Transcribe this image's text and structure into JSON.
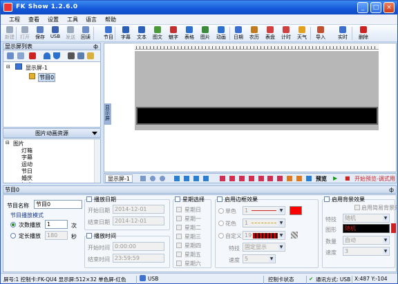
{
  "window": {
    "title": "FK Show 1.2.6.0",
    "btn_min": "_",
    "btn_max": "□",
    "btn_close": "×"
  },
  "menu": [
    "工程",
    "查看",
    "设置",
    "工具",
    "语言",
    "帮助"
  ],
  "toolbar": {
    "items": [
      "新建",
      "打开",
      "保存",
      "USB",
      "发送",
      "回读",
      "节目",
      "字幕",
      "文本",
      "图文",
      "魅字",
      "表格",
      "图片",
      "动画",
      "日期",
      "农历",
      "表盘",
      "计时",
      "天气",
      "导入",
      "实时",
      "删除"
    ],
    "disabled": [
      true,
      true,
      false,
      false,
      true,
      false,
      false,
      false,
      false,
      false,
      false,
      false,
      false,
      false,
      false,
      false,
      false,
      false,
      false,
      false,
      false,
      false
    ],
    "colors": [
      "#9aa8bb",
      "#9aa8bb",
      "#5a7fc0",
      "#3a5fb0",
      "#9aa8bb",
      "#6b8cc9",
      "#3a74d0",
      "#2b5fb8",
      "#2b5fb8",
      "#4a9a3a",
      "#c03030",
      "#2b6fcf",
      "#3d8a3d",
      "#2b6fcf",
      "#3b6fcf",
      "#c07a20",
      "#d04040",
      "#d04040",
      "#e0a020",
      "#c05030",
      "#3b6fcf",
      "#cc2222"
    ]
  },
  "left": {
    "list_title": "显示屏列表",
    "pin": "ф",
    "tree": [
      {
        "label": "显示屏-1",
        "level": 0
      },
      {
        "label": "节目0",
        "level": 1
      }
    ],
    "anim_title": "图片动画资源",
    "anim_tree": [
      "图片",
      "灯箱",
      "字幕",
      "运动",
      "节日",
      "婚庆",
      "好吉"
    ]
  },
  "canvas": {
    "vruler": "显示屏"
  },
  "bottom": {
    "tab": "显示屏-1",
    "preview": "预览",
    "play_label": "开始预览-调式用"
  },
  "props": {
    "title": "节目0",
    "pin": "ф",
    "program_name_label": "节目名称",
    "program_name": "节目0",
    "play_mode_label": "节目播放模式",
    "mode_count_label": "次数播放",
    "count_value": "1",
    "count_unit": "次",
    "mode_timed_label": "定长播放",
    "timed_value": "180",
    "timed_unit": "秒",
    "date_group": "播放日期",
    "start_date_label": "开始日期",
    "start_date": "2014-12-01",
    "end_date_label": "结束日期",
    "end_date": "2014-12-01",
    "time_group": "播放时间",
    "start_time_label": "开始时间",
    "start_time": "0:00:00",
    "end_time_label": "结束时间",
    "end_time": "23:59:59",
    "week_group": "星期选择",
    "weekdays": [
      "星期日",
      "星期一",
      "星期二",
      "星期三",
      "星期四",
      "星期五",
      "星期六"
    ],
    "border_group": "启用边框效果",
    "border_single": "单色",
    "border_single_val": "1",
    "border_color": "#ff0000",
    "border_flower": "花色",
    "border_flower_val": "1",
    "border_custom": "自定义",
    "border_custom_val": "19",
    "effect_label": "特技",
    "effect_val": "固定显示",
    "speed_label": "速度",
    "speed_val": "5",
    "bg_group": "启用背景效果",
    "bg_simple": "启用简易背景效",
    "bg_effect_label": "特技",
    "bg_effect_val": "随机",
    "bg_shape_label": "图形",
    "bg_shape_val": "随机",
    "bg_count_label": "数量",
    "bg_count_val": "自动",
    "bg_speed_label": "速度",
    "bg_speed_val": "3"
  },
  "status": {
    "screen": "屏号:1 控制卡:FK-QU4 显示屏:512×32 单色屏-红色",
    "usb": "USB",
    "card_state": "控制卡状态",
    "comm": "通讯方式: USB",
    "coords": "X:487 Y:-104"
  }
}
